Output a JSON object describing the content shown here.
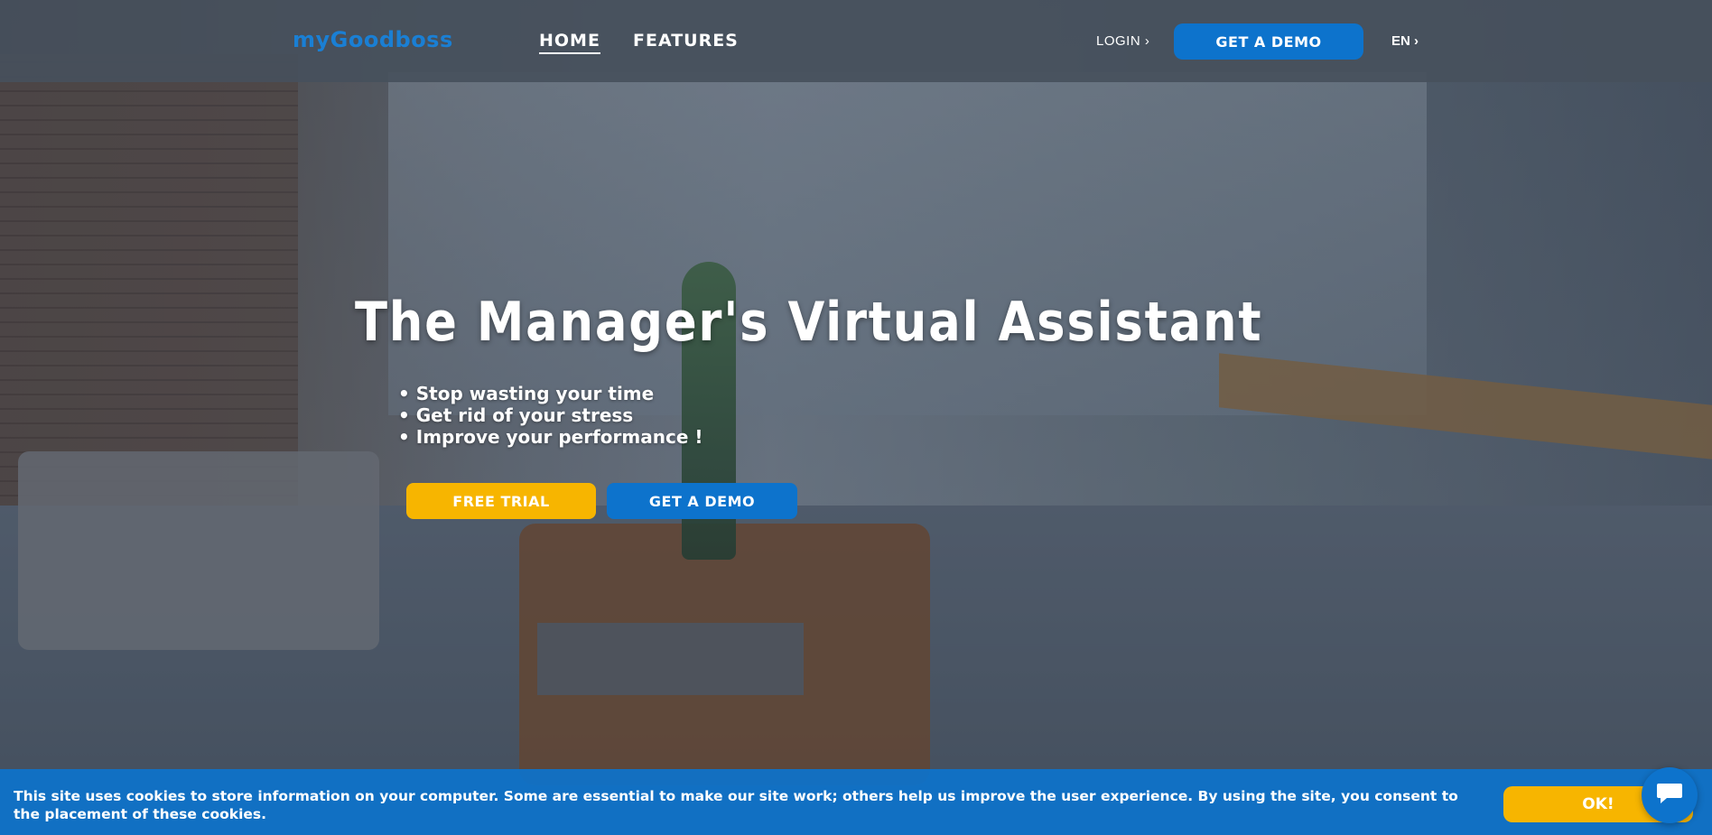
{
  "header": {
    "logo": "myGoodboss",
    "nav": [
      {
        "label": "HOME",
        "active": true
      },
      {
        "label": "FEATURES",
        "active": false
      }
    ],
    "login_label": "LOGIN",
    "demo_label": "GET A DEMO",
    "lang_label": "EN"
  },
  "hero": {
    "title": "The Manager's Virtual Assistant",
    "bullets": [
      "• Stop wasting your time",
      "• Get rid of your stress",
      "• Improve your performance !"
    ],
    "trial_label": "FREE TRIAL",
    "demo_label": "GET A DEMO"
  },
  "cookie": {
    "text": "This site uses cookies to store information on your computer. Some are essential to make our site work; others help us improve the user experience. By using the site, you consent to the placement of these cookies.",
    "ok_label": "OK!"
  },
  "icons": {
    "chevron": "chevron-right-icon",
    "chat": "chat-bubble-icon"
  },
  "colors": {
    "brand_blue": "#0d73cc",
    "accent_yellow": "#f7b500",
    "logo_blue": "#1a7fd4"
  }
}
